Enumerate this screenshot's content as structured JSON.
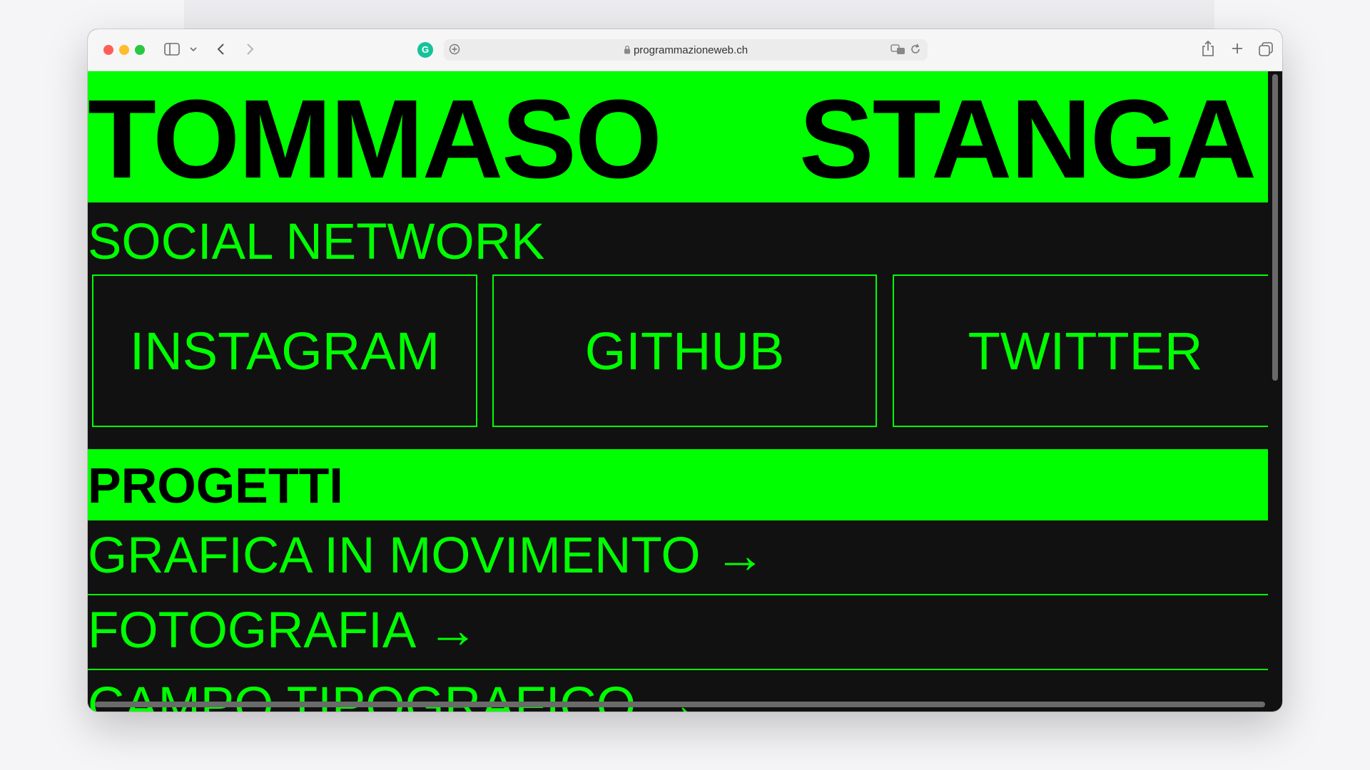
{
  "browser": {
    "url": "programmazioneweb.ch",
    "grammarly_glyph": "G"
  },
  "hero": {
    "first_name": "TOMMASO",
    "last_name": "STANGA"
  },
  "social": {
    "title": "SOCIAL NETWORK",
    "links": [
      "INSTAGRAM",
      "GITHUB",
      "TWITTER"
    ]
  },
  "projects": {
    "title": "PROGETTI",
    "items": [
      "GRAFICA IN MOVIMENTO →",
      "FOTOGRAFIA →",
      "CAMPO TIPOGRAFICO →"
    ]
  },
  "colors": {
    "accent": "#00ff00",
    "background": "#111111",
    "text_dark": "#000000"
  }
}
